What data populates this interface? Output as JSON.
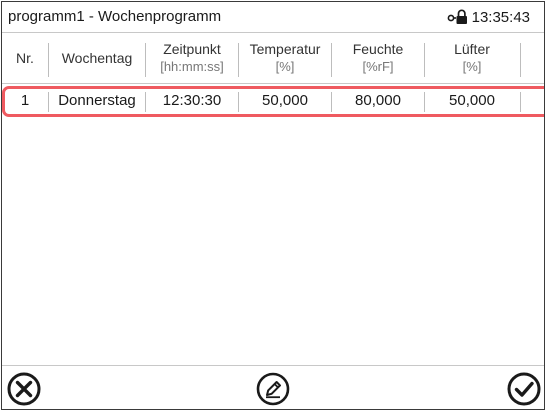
{
  "window": {
    "title": "programm1 - Wochenprogramm",
    "time": "13:35:43",
    "status_icon": "lock-icon"
  },
  "table": {
    "columns": [
      {
        "key": "nr",
        "label": "Nr.",
        "unit": ""
      },
      {
        "key": "wochentag",
        "label": "Wochentag",
        "unit": ""
      },
      {
        "key": "zeitpunkt",
        "label": "Zeitpunkt",
        "unit": "[hh:mm:ss]"
      },
      {
        "key": "temperatur",
        "label": "Temperatur",
        "unit": "[%]"
      },
      {
        "key": "feuchte",
        "label": "Feuchte",
        "unit": "[%rF]"
      },
      {
        "key": "luefter",
        "label": "Lüfter",
        "unit": "[%]"
      }
    ],
    "rows": [
      {
        "nr": "1",
        "wochentag": "Donnerstag",
        "zeitpunkt": "12:30:30",
        "temperatur": "50,000",
        "feuchte": "80,000",
        "luefter": "50,000"
      }
    ],
    "selected_row": 1
  },
  "footer": {
    "cancel_icon": "close-circle-icon",
    "edit_icon": "edit-pencil-icon",
    "confirm_icon": "check-circle-icon"
  },
  "colors": {
    "highlight": "#ef5a60",
    "separator": "#bdbdbd",
    "text": "#1a1a1a"
  }
}
